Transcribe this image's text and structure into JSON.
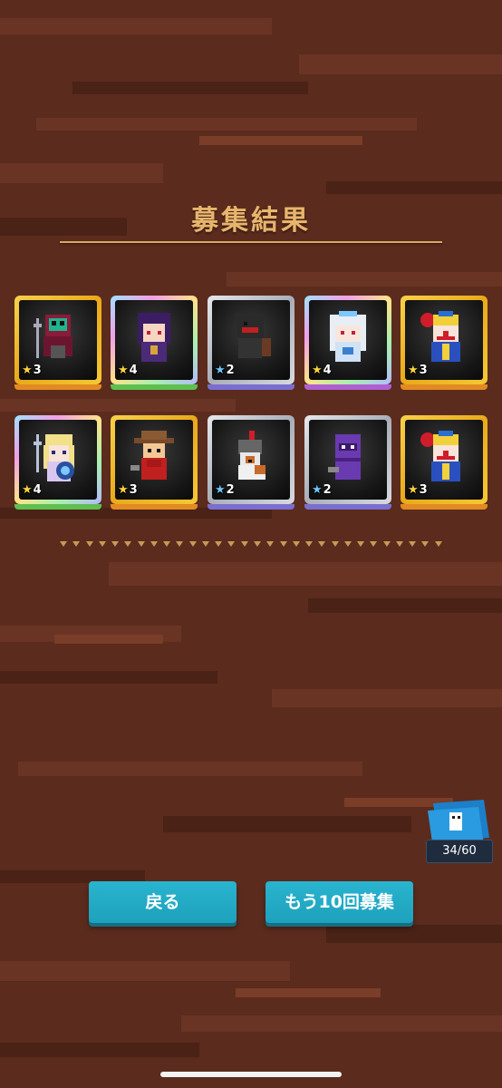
{
  "screen": {
    "title": "募集結果"
  },
  "results": [
    {
      "stars": "3",
      "rarity": "gold",
      "character": "robot-knight"
    },
    {
      "stars": "4",
      "rarity": "rainbow",
      "character": "witch-girl"
    },
    {
      "stars": "2",
      "rarity": "silver",
      "character": "black-dog"
    },
    {
      "stars": "4",
      "rarity": "rainbow",
      "character": "ice-princess"
    },
    {
      "stars": "3",
      "rarity": "gold",
      "character": "clown"
    },
    {
      "stars": "4",
      "rarity": "rainbow",
      "character": "blonde-knight"
    },
    {
      "stars": "3",
      "rarity": "gold",
      "character": "cowboy"
    },
    {
      "stars": "2",
      "rarity": "silver",
      "character": "helmet-dog"
    },
    {
      "stars": "2",
      "rarity": "silver",
      "character": "purple-ninja"
    },
    {
      "stars": "3",
      "rarity": "gold",
      "character": "clown"
    }
  ],
  "ticket": {
    "icon": "ticket-icon",
    "count": "34/60"
  },
  "buttons": {
    "back": "戻る",
    "recruit_again": "もう10回募集"
  },
  "colors": {
    "title": "#e7b56c",
    "button": "#1ea1bc",
    "background": "#5a2a1c"
  }
}
